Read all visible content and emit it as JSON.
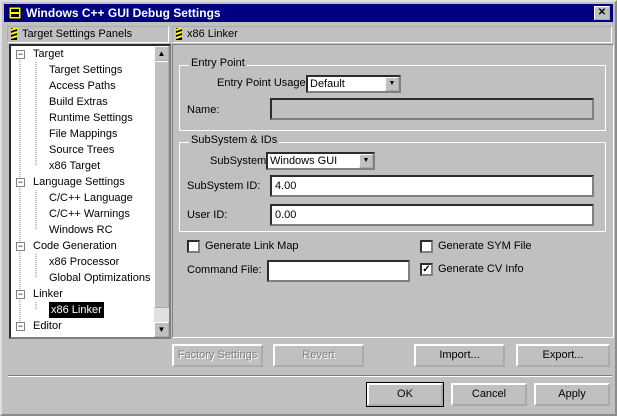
{
  "window": {
    "title": "Windows C++ GUI Debug Settings",
    "close_glyph": "✕"
  },
  "left_panel": {
    "header": "Target Settings Panels",
    "tree": [
      {
        "label": "Target",
        "level": 0,
        "expander": "−"
      },
      {
        "label": "Target Settings",
        "level": 1
      },
      {
        "label": "Access Paths",
        "level": 1
      },
      {
        "label": "Build Extras",
        "level": 1
      },
      {
        "label": "Runtime Settings",
        "level": 1
      },
      {
        "label": "File Mappings",
        "level": 1
      },
      {
        "label": "Source Trees",
        "level": 1
      },
      {
        "label": "x86 Target",
        "level": 1
      },
      {
        "label": "Language Settings",
        "level": 0,
        "expander": "−"
      },
      {
        "label": "C/C++ Language",
        "level": 1
      },
      {
        "label": "C/C++ Warnings",
        "level": 1
      },
      {
        "label": "Windows RC",
        "level": 1
      },
      {
        "label": "Code Generation",
        "level": 0,
        "expander": "−"
      },
      {
        "label": "x86 Processor",
        "level": 1
      },
      {
        "label": "Global Optimizations",
        "level": 1
      },
      {
        "label": "Linker",
        "level": 0,
        "expander": "−"
      },
      {
        "label": "x86 Linker",
        "level": 1,
        "selected": true
      },
      {
        "label": "Editor",
        "level": 0,
        "expander": "−"
      }
    ]
  },
  "right_panel": {
    "header": "x86 Linker",
    "entry_point": {
      "group_title": "Entry Point",
      "usage_label": "Entry Point Usage:",
      "usage_value": "Default",
      "name_label": "Name:",
      "name_value": ""
    },
    "subsystem": {
      "group_title": "SubSystem & IDs",
      "subsystem_label": "SubSystem:",
      "subsystem_value": "Windows GUI",
      "subsystem_id_label": "SubSystem ID:",
      "subsystem_id_value": "4.00",
      "user_id_label": "User ID:",
      "user_id_value": "0.00"
    },
    "options": {
      "generate_link_map": {
        "label": "Generate Link Map",
        "checked": false
      },
      "generate_sym_file": {
        "label": "Generate SYM File",
        "checked": false
      },
      "generate_cv_info": {
        "label": "Generate CV Info",
        "checked": true
      },
      "command_file_label": "Command File:",
      "command_file_value": ""
    }
  },
  "panel_buttons": {
    "factory_settings": "Factory Settings",
    "revert": "Revert",
    "import": "Import...",
    "export": "Export..."
  },
  "dialog_buttons": {
    "ok": "OK",
    "cancel": "Cancel",
    "apply": "Apply"
  },
  "colors": {
    "titlebar": "#000080",
    "face": "#c0c0c0",
    "selection": "#000000"
  }
}
